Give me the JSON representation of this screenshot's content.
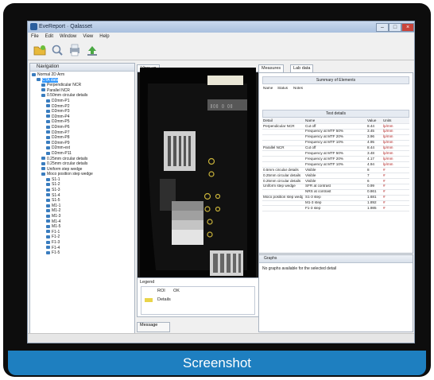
{
  "window": {
    "title": "EveReport · Qalasset",
    "buttons": [
      "–",
      "□",
      "×"
    ]
  },
  "menu": [
    "File",
    "Edit",
    "Window",
    "View",
    "Help"
  ],
  "toolbar": {
    "icons": [
      "open-folder-icon",
      "search-icon",
      "print-icon",
      "export-icon"
    ]
  },
  "navigation": {
    "title": "Navigation",
    "items": [
      {
        "label": "Normal 2D Arm",
        "level": 0
      },
      {
        "label": "CTA data",
        "level": 1,
        "selected": true
      },
      {
        "label": "Perpendicular NCR",
        "level": 2
      },
      {
        "label": "Parallel NCR",
        "level": 2
      },
      {
        "label": "0.50mm circular details",
        "level": 2
      },
      {
        "label": "D2mm-P1",
        "level": 3
      },
      {
        "label": "D2mm-P2",
        "level": 3
      },
      {
        "label": "D2mm-P3",
        "level": 3
      },
      {
        "label": "D2mm-P4",
        "level": 3
      },
      {
        "label": "D2mm-P5",
        "level": 3
      },
      {
        "label": "D2mm-P6",
        "level": 3
      },
      {
        "label": "D2mm-P7",
        "level": 3
      },
      {
        "label": "D2mm-P8",
        "level": 3
      },
      {
        "label": "D2mm-P9",
        "level": 3
      },
      {
        "label": "D2mm-ext",
        "level": 3
      },
      {
        "label": "D2mm-P11",
        "level": 3
      },
      {
        "label": "0.25mm circular details",
        "level": 2
      },
      {
        "label": "0.25mm circular details",
        "level": 2
      },
      {
        "label": "Uniform step wedge",
        "level": 2
      },
      {
        "label": "Moco position step wedge",
        "level": 2
      },
      {
        "label": "S1-1",
        "level": 3
      },
      {
        "label": "S1-2",
        "level": 3
      },
      {
        "label": "S1-3",
        "level": 3
      },
      {
        "label": "S1-4",
        "level": 3
      },
      {
        "label": "S1-5",
        "level": 3
      },
      {
        "label": "M1-1",
        "level": 3
      },
      {
        "label": "M1-2",
        "level": 3
      },
      {
        "label": "M1-3",
        "level": 3
      },
      {
        "label": "M1-4",
        "level": 3
      },
      {
        "label": "M1-5",
        "level": 3
      },
      {
        "label": "F1-1",
        "level": 3
      },
      {
        "label": "F1-2",
        "level": 3
      },
      {
        "label": "F1-3",
        "level": 3
      },
      {
        "label": "F1-4",
        "level": 3
      },
      {
        "label": "F1-5",
        "level": 3
      }
    ]
  },
  "view": {
    "tab": "View up"
  },
  "legend": {
    "title": "Legend",
    "col1": "ROI",
    "col2": "OK",
    "swatch_label": "Details"
  },
  "message_tab": "Message",
  "right_tabs": [
    "Measures",
    "Lab data"
  ],
  "results": {
    "summary_title": "Summary of Elements",
    "summary_row": [
      "Name",
      "Status",
      "Notes"
    ],
    "detail_title": "Test details",
    "columns": [
      "Detail",
      "Name",
      "Value",
      "Units"
    ],
    "rows": [
      [
        "Perpendicular NCR",
        "Cut off",
        "8.44",
        "lp/mm"
      ],
      [
        "",
        "Frequency at MTF 50%",
        "3.45",
        "lp/mm"
      ],
      [
        "",
        "Frequency at MTF 20%",
        "3.96",
        "lp/mm"
      ],
      [
        "",
        "Frequency at MTF 10%",
        "4.95",
        "lp/mm"
      ],
      [
        "Parallel NCR",
        "Cut off",
        "8.44",
        "lp/mm"
      ],
      [
        "",
        "Frequency at MTF 50%",
        "3.48",
        "lp/mm"
      ],
      [
        "",
        "Frequency at MTF 20%",
        "4.17",
        "lp/mm"
      ],
      [
        "",
        "Frequency at MTF 10%",
        "4.94",
        "lp/mm"
      ],
      [
        "0.5mm circular details",
        "Visible",
        "8",
        "#"
      ],
      [
        "0.25mm circular details",
        "Visible",
        "7",
        "#"
      ],
      [
        "0.25mm circular details",
        "Visible",
        "6",
        "#"
      ],
      [
        "Uniform step wedge",
        "SFR at contrast",
        "0.99",
        "#"
      ],
      [
        "",
        "NRS at contrast",
        "0.861",
        "#"
      ],
      [
        "Moco position step wedge",
        "S1-3 step",
        "1.681",
        "#"
      ],
      [
        "",
        "M1-3 step",
        "1.892",
        "#"
      ],
      [
        "",
        "F1-3 step",
        "1.985",
        "#"
      ]
    ]
  },
  "graphs": {
    "tab": "Graphs",
    "empty_text": "No graphs available for the selected detail"
  },
  "caption": "Screenshot",
  "colors": {
    "caption_bar": "#1e7fc0",
    "bezel": "#0d0d0d",
    "selection": "#3399ff"
  }
}
